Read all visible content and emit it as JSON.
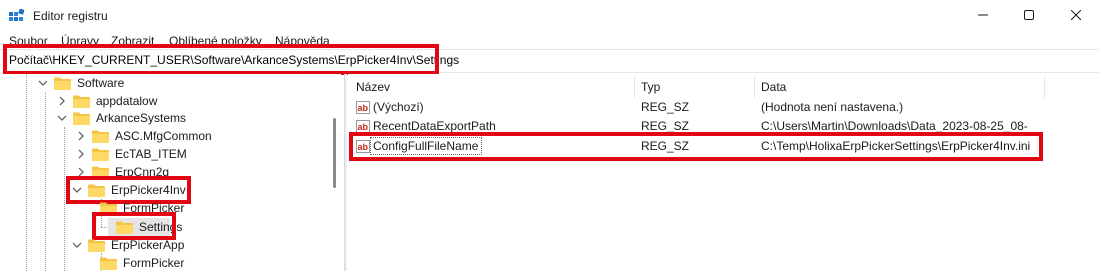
{
  "window": {
    "title": "Editor registru",
    "minimize_icon": "minimize-icon",
    "maximize_icon": "maximize-icon",
    "close_icon": "close-icon"
  },
  "menu": [
    "Soubor",
    "Úpravy",
    "Zobrazit",
    "Oblíbené položky",
    "Nápověda"
  ],
  "address": {
    "path": "Počítač\\HKEY_CURRENT_USER\\Software\\ArkanceSystems\\ErpPicker4Inv\\Settings"
  },
  "tree": {
    "nodes": [
      {
        "label": "Software",
        "state": "expanded"
      },
      {
        "label": "appdatalow",
        "state": "collapsed"
      },
      {
        "label": "ArkanceSystems",
        "state": "expanded"
      },
      {
        "label": "ASC.MfgCommon",
        "state": "collapsed"
      },
      {
        "label": "EcTAB_ITEM",
        "state": "collapsed"
      },
      {
        "label": "ErpCnn2g",
        "state": "collapsed"
      },
      {
        "label": "ErpPicker4Inv",
        "state": "expanded"
      },
      {
        "label": "FormPicker",
        "state": "leaf"
      },
      {
        "label": "Settings",
        "state": "leaf-selected"
      },
      {
        "label": "ErpPickerApp",
        "state": "expanded"
      },
      {
        "label": "FormPicker",
        "state": "leaf"
      }
    ]
  },
  "list": {
    "columns": [
      "Název",
      "Typ",
      "Data"
    ],
    "rows": [
      {
        "name": "(Výchozí)",
        "type": "REG_SZ",
        "data": "(Hodnota není nastavena.)"
      },
      {
        "name": "RecentDataExportPath",
        "type": "REG_SZ",
        "data": "C:\\Users\\Martin\\Downloads\\Data_2023-08-25_08-"
      },
      {
        "name": "ConfigFullFileName",
        "type": "REG_SZ",
        "data": "C:\\Temp\\HolixaErpPickerSettings\\ErpPicker4Inv.ini"
      }
    ],
    "value_icon": "string-value-icon"
  },
  "colors": {
    "highlight_red": "#e30613",
    "folder_yellow": "#f4c443",
    "ab_icon_red": "#c42b1c"
  }
}
